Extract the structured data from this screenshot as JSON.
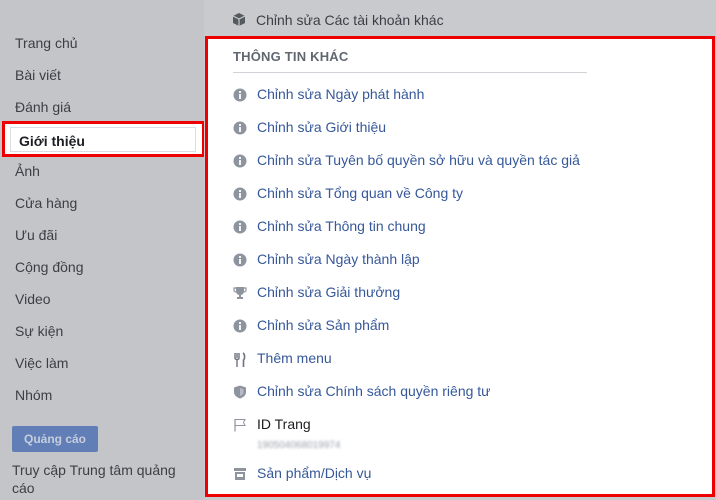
{
  "sidebar": {
    "items": [
      {
        "label": "Trang chủ"
      },
      {
        "label": "Bài viết"
      },
      {
        "label": "Đánh giá"
      },
      {
        "label": "Giới thiệu",
        "active": true
      },
      {
        "label": "Ảnh"
      },
      {
        "label": "Cửa hàng"
      },
      {
        "label": "Ưu đãi"
      },
      {
        "label": "Cộng đồng"
      },
      {
        "label": "Video"
      },
      {
        "label": "Sự kiện"
      },
      {
        "label": "Việc làm"
      },
      {
        "label": "Nhóm"
      }
    ],
    "ads_button": "Quảng cáo",
    "ads_center_link": "Truy cập Trung tâm quảng cáo"
  },
  "main": {
    "top_row": {
      "label": "Chỉnh sửa Các tài khoản khác",
      "icon": "cube-icon"
    },
    "section_title": "THÔNG TIN KHÁC",
    "rows": [
      {
        "label": "Chỉnh sửa Ngày phát hành",
        "icon": "info-icon"
      },
      {
        "label": "Chỉnh sửa Giới thiệu",
        "icon": "info-icon"
      },
      {
        "label": "Chỉnh sửa Tuyên bố quyền sở hữu và quyền tác giả",
        "icon": "info-icon"
      },
      {
        "label": "Chỉnh sửa Tổng quan về Công ty",
        "icon": "info-icon"
      },
      {
        "label": "Chỉnh sửa Thông tin chung",
        "icon": "info-icon"
      },
      {
        "label": "Chỉnh sửa Ngày thành lập",
        "icon": "info-icon"
      },
      {
        "label": "Chỉnh sửa Giải thưởng",
        "icon": "trophy-icon"
      },
      {
        "label": "Chỉnh sửa Sản phẩm",
        "icon": "info-icon"
      },
      {
        "label": "Thêm menu",
        "icon": "fork-knife-icon"
      },
      {
        "label": "Chỉnh sửa Chính sách quyền riêng tư",
        "icon": "shield-icon"
      },
      {
        "label": "ID Trang",
        "icon": "flag-icon",
        "value": "190504068019974"
      },
      {
        "label": "Sản phẩm/Dịch vụ",
        "icon": "shop-icon"
      }
    ]
  },
  "colors": {
    "highlight_border": "#ee0000",
    "link": "#365899",
    "ads_button": "#4267b2"
  }
}
